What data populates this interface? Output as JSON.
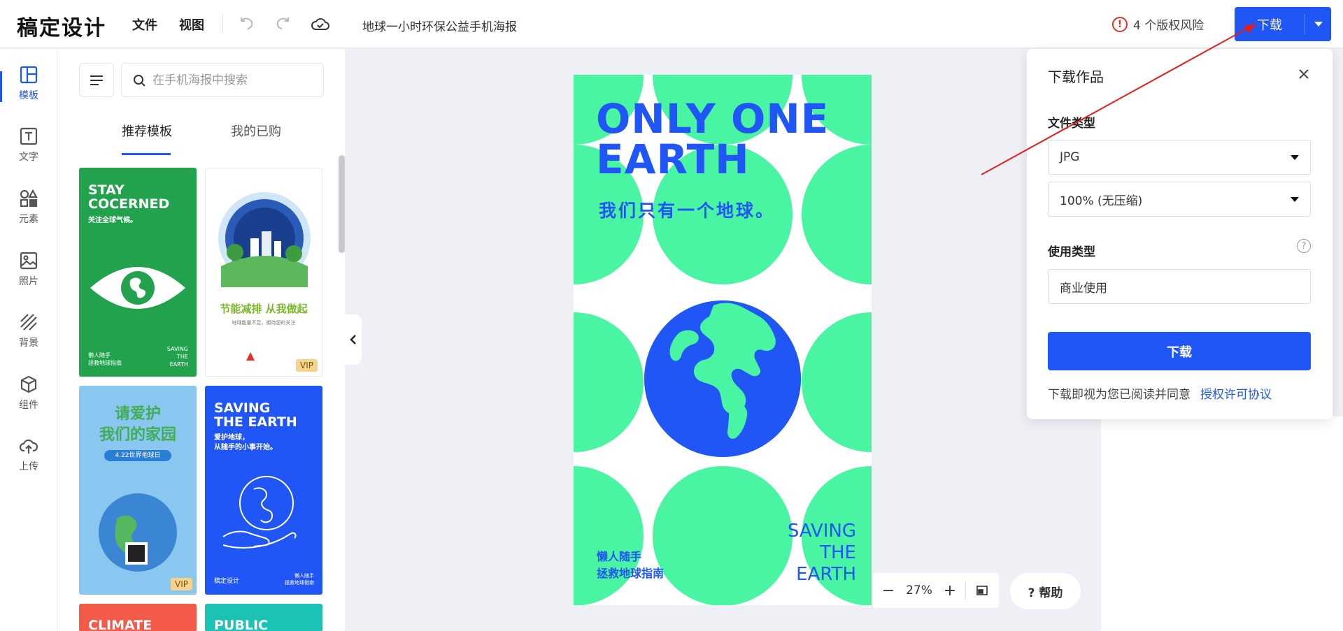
{
  "app": {
    "logo": "稿定设计",
    "menu": [
      "文件",
      "视图"
    ],
    "doc_title": "地球一小时环保公益手机海报",
    "risk_text": "4 个版权风险",
    "download_label": "下载"
  },
  "rail": [
    {
      "label": "模板",
      "icon": "template-icon"
    },
    {
      "label": "文字",
      "icon": "text-icon"
    },
    {
      "label": "元素",
      "icon": "elements-icon"
    },
    {
      "label": "照片",
      "icon": "photo-icon"
    },
    {
      "label": "背景",
      "icon": "background-icon"
    },
    {
      "label": "组件",
      "icon": "component-icon"
    },
    {
      "label": "上传",
      "icon": "upload-icon"
    }
  ],
  "panel": {
    "search_placeholder": "在手机海报中搜索",
    "tabs": [
      "推荐模板",
      "我的已购"
    ],
    "templates": [
      {
        "title": "STAY\nCOCERNED",
        "sub": "关注全球气候。",
        "footer_left": "懒人随手\n拯救地球指南",
        "footer_right": "SAVING\nTHE\nEARTH"
      },
      {
        "title": "节能减排 从我做起",
        "sub": "地球能量不足，期待您的关注",
        "badge": "VIP"
      },
      {
        "title": "请爱护\n我们的家园",
        "sub": "4.22世界地球日",
        "badge": "VIP"
      },
      {
        "title": "SAVING\nTHE EARTH",
        "sub": "爱护地球，\n从随手的小事开始。",
        "footer_left": "稿定设计",
        "footer_right": "懒人随手\n拯救地球指南"
      },
      {
        "title": "CLIMATE"
      },
      {
        "title": "PUBLIC"
      }
    ]
  },
  "poster": {
    "headline": "ONLY ONE\nEARTH",
    "subtitle": "我们只有一个地球。",
    "bottom_left": "懒人随手\n拯救地球指南",
    "bottom_right": "SAVING\nTHE\nEARTH",
    "colors": {
      "green": "#49f5a3",
      "blue": "#1f56f5"
    }
  },
  "zoom": {
    "minus": "−",
    "value": "27%",
    "plus": "+"
  },
  "help_label": "? 帮助",
  "download_panel": {
    "title": "下载作品",
    "file_type_label": "文件类型",
    "file_type": "JPG",
    "quality": "100% (无压缩)",
    "usage_label": "使用类型",
    "usage": "商业使用",
    "button": "下载",
    "note": "下载即视为您已阅读并同意",
    "license_link": "授权许可协议"
  }
}
